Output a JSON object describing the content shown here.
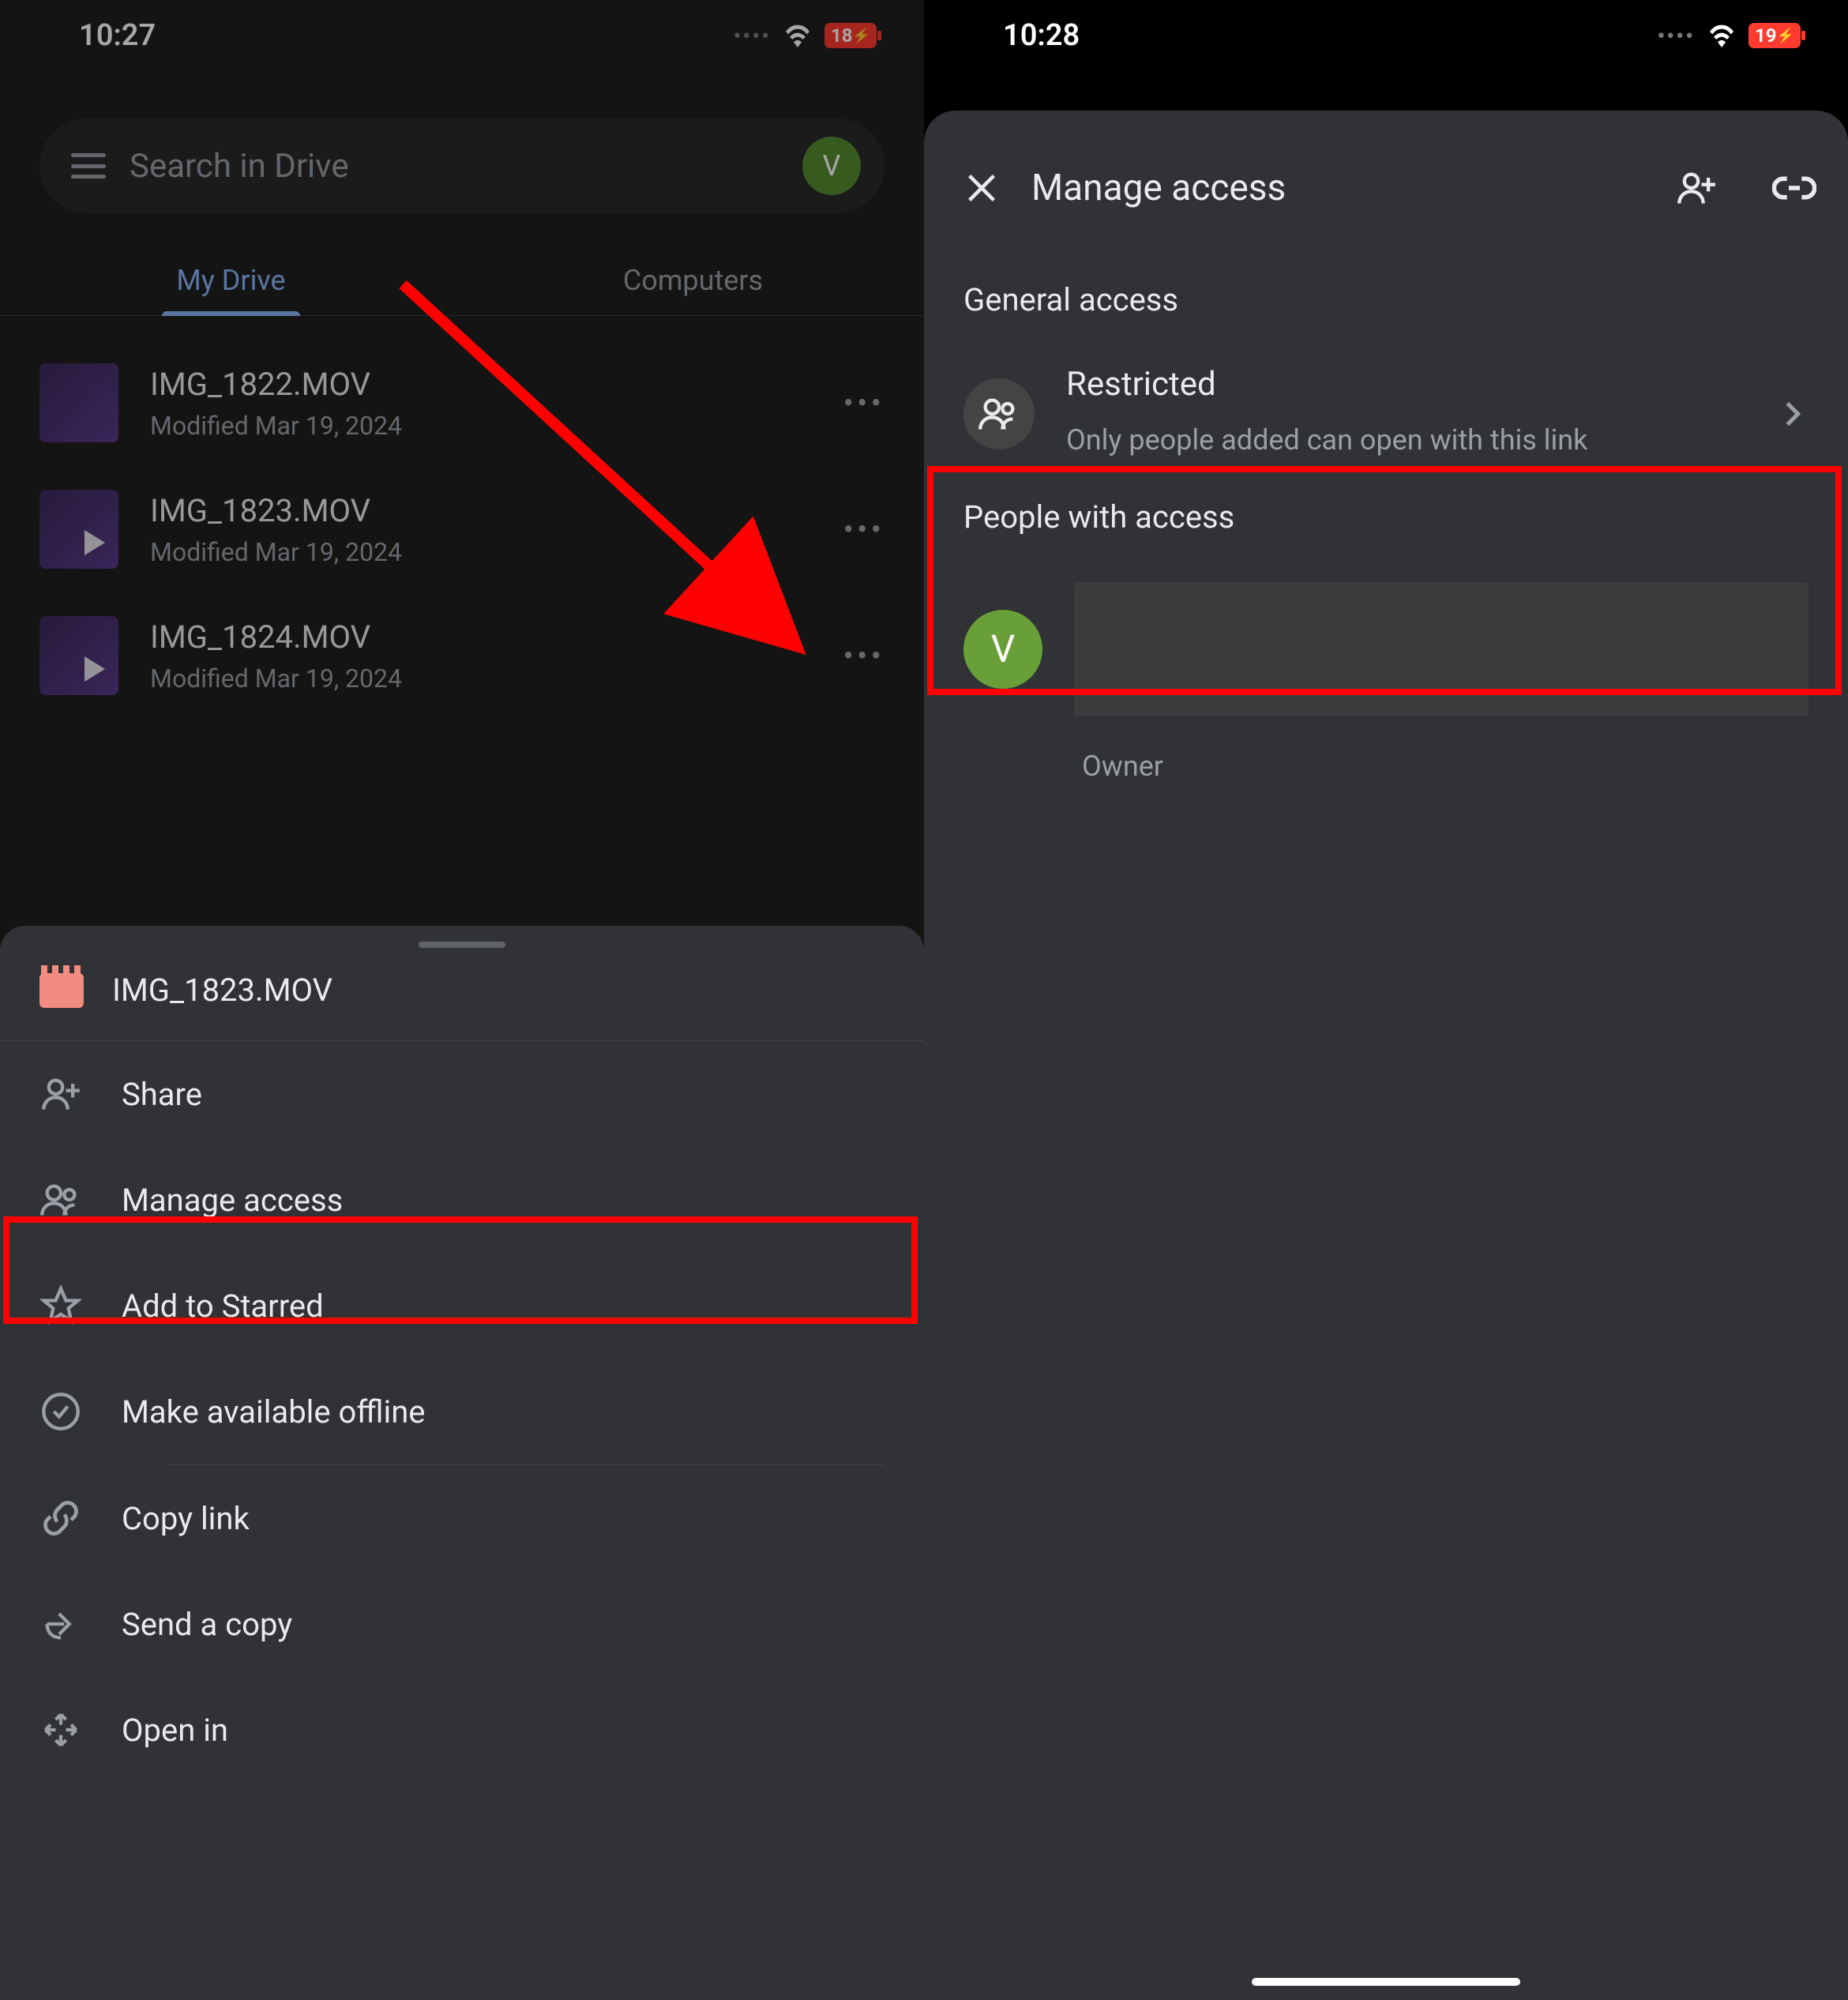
{
  "left": {
    "time": "10:27",
    "battery": "18",
    "search_placeholder": "Search in Drive",
    "avatar": "V",
    "tabs": {
      "mydrive": "My Drive",
      "computers": "Computers"
    },
    "files": [
      {
        "name": "IMG_1822.MOV",
        "modified": "Modified Mar 19, 2024"
      },
      {
        "name": "IMG_1823.MOV",
        "modified": "Modified Mar 19, 2024"
      },
      {
        "name": "IMG_1824.MOV",
        "modified": "Modified Mar 19, 2024"
      }
    ],
    "sheet": {
      "title": "IMG_1823.MOV",
      "items": {
        "share": "Share",
        "manage": "Manage access",
        "star": "Add to Starred",
        "offline": "Make available offline",
        "copylink": "Copy link",
        "sendcopy": "Send a copy",
        "openin": "Open in"
      }
    }
  },
  "right": {
    "time": "10:28",
    "battery": "19",
    "title": "Manage access",
    "general_label": "General access",
    "restricted": {
      "title": "Restricted",
      "desc": "Only people added can open with this link"
    },
    "people_label": "People with access",
    "owner": {
      "initial": "V",
      "role": "Owner"
    }
  }
}
